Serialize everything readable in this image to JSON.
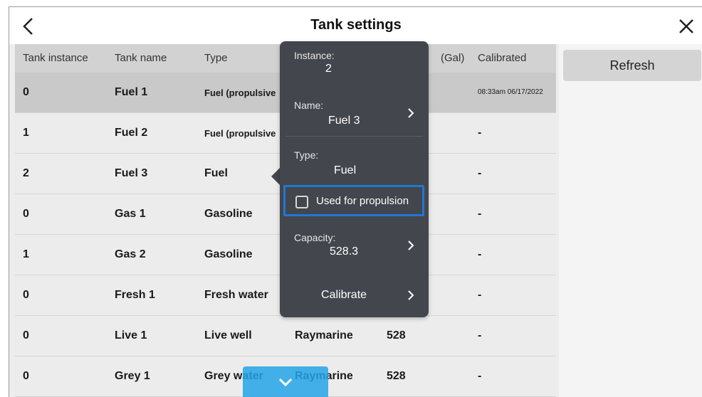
{
  "header": {
    "title": "Tank settings",
    "back_icon": "chevron-left-icon",
    "close_icon": "close-icon"
  },
  "table": {
    "columns": [
      "Tank instance",
      "Tank name",
      "Type",
      "(Gal)",
      "Calibrated"
    ],
    "rows": [
      {
        "instance": "0",
        "name": "Fuel 1",
        "type": "Fuel (propulsive",
        "manufacturer": "",
        "capacity": "",
        "calibrated": "08:33am 06/17/2022"
      },
      {
        "instance": "1",
        "name": "Fuel 2",
        "type": "Fuel (propulsive",
        "manufacturer": "",
        "capacity": "",
        "calibrated": "-"
      },
      {
        "instance": "2",
        "name": "Fuel 3",
        "type": "Fuel",
        "manufacturer": "",
        "capacity": "",
        "calibrated": "-"
      },
      {
        "instance": "0",
        "name": "Gas 1",
        "type": "Gasoline",
        "manufacturer": "",
        "capacity": "",
        "calibrated": "-"
      },
      {
        "instance": "1",
        "name": "Gas 2",
        "type": "Gasoline",
        "manufacturer": "",
        "capacity": "",
        "calibrated": "-"
      },
      {
        "instance": "0",
        "name": "Fresh 1",
        "type": "Fresh water",
        "manufacturer": "",
        "capacity": "",
        "calibrated": "-"
      },
      {
        "instance": "0",
        "name": "Live 1",
        "type": "Live well",
        "manufacturer": "Raymarine",
        "capacity": "528",
        "calibrated": "-"
      },
      {
        "instance": "0",
        "name": "Grey 1",
        "type": "Grey water",
        "manufacturer": "Raymarine",
        "capacity": "528",
        "calibrated": "-"
      }
    ]
  },
  "sidebar": {
    "refresh_label": "Refresh"
  },
  "popover": {
    "instance_label": "Instance:",
    "instance_value": "2",
    "name_label": "Name:",
    "name_value": "Fuel 3",
    "type_label": "Type:",
    "type_value": "Fuel",
    "propulsion_label": "Used for propulsion",
    "propulsion_checked": false,
    "capacity_label": "Capacity:",
    "capacity_value": "528.3",
    "calibrate_label": "Calibrate"
  },
  "scroll": {
    "icon": "chevron-down-icon"
  },
  "colors": {
    "accent": "#1e78d2",
    "popover_bg": "#43464c",
    "selected_row": "#c9c9c9",
    "scroll_button": "#26a4e8"
  }
}
